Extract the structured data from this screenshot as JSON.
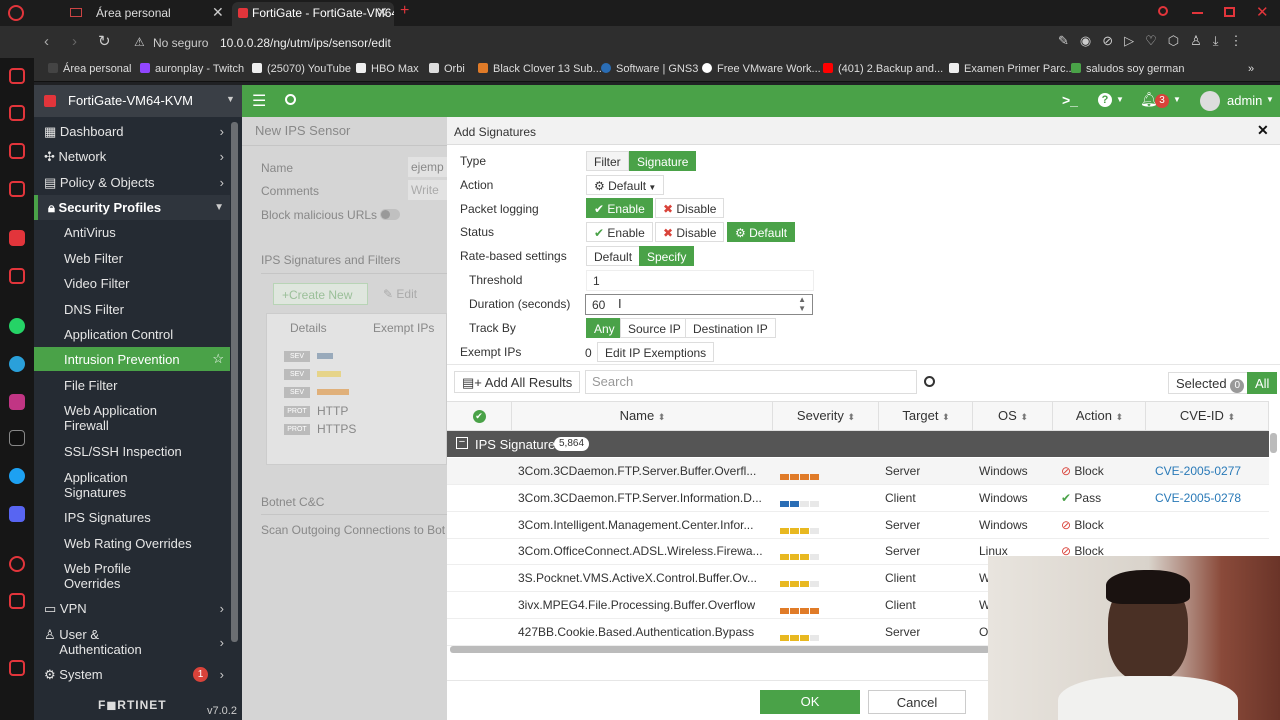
{
  "browser": {
    "tabs": [
      {
        "title": "Área personal"
      },
      {
        "title": "FortiGate - FortiGate-VM64"
      }
    ],
    "new_tab": "+",
    "url_prefix": "No seguro",
    "url": "10.0.0.28/ng/utm/ips/sensor/edit",
    "bookmarks": [
      "Área personal",
      "auronplay - Twitch",
      "(25070) YouTube",
      "HBO Max",
      "Orbi",
      "Black Clover 13 Sub...",
      "Software | GNS3",
      "Free VMware Work...",
      "(401) 2.Backup and...",
      "Examen Primer Parc...",
      "saludos soy german"
    ]
  },
  "header": {
    "device": "FortiGate-VM64-KVM",
    "notif_count": "3",
    "user": "admin"
  },
  "sidebar": {
    "items": [
      {
        "label": "Dashboard"
      },
      {
        "label": "Network"
      },
      {
        "label": "Policy & Objects"
      },
      {
        "label": "Security Profiles"
      },
      {
        "label": "AntiVirus"
      },
      {
        "label": "Web Filter"
      },
      {
        "label": "Video Filter"
      },
      {
        "label": "DNS Filter"
      },
      {
        "label": "Application Control"
      },
      {
        "label": "Intrusion Prevention"
      },
      {
        "label": "File Filter"
      },
      {
        "label": "Web Application Firewall"
      },
      {
        "label": "SSL/SSH Inspection"
      },
      {
        "label": "Application Signatures"
      },
      {
        "label": "IPS Signatures"
      },
      {
        "label": "Web Rating Overrides"
      },
      {
        "label": "Web Profile Overrides"
      },
      {
        "label": "VPN"
      },
      {
        "label": "User & Authentication"
      },
      {
        "label": "System"
      }
    ],
    "system_badge": "1",
    "brand": "F◼RTINET",
    "version": "v7.0.2"
  },
  "content": {
    "title": "New IPS Sensor",
    "name_label": "Name",
    "name_value": "ejemp",
    "comments_label": "Comments",
    "comments_placeholder": "Write",
    "block_label": "Block malicious URLs",
    "section": "IPS Signatures and Filters",
    "create_new": "Create New",
    "edit": "Edit",
    "col_details": "Details",
    "col_exempt": "Exempt IPs",
    "tags": [
      "SEV",
      "SEV",
      "SEV",
      "PROT",
      "PROT"
    ],
    "protocols": [
      "HTTP",
      "HTTPS"
    ],
    "botnet": "Botnet C&C",
    "scan": "Scan Outgoing Connections to Bot"
  },
  "modal": {
    "title": "Add Signatures",
    "type_label": "Type",
    "type_filter": "Filter",
    "type_signature": "Signature",
    "action_label": "Action",
    "action_value": "Default",
    "logging_label": "Packet logging",
    "enable": "Enable",
    "disable": "Disable",
    "status_label": "Status",
    "status_default": "Default",
    "rate_label": "Rate-based settings",
    "rate_default": "Default",
    "rate_specify": "Specify",
    "threshold_label": "Threshold",
    "threshold_value": "1",
    "duration_label": "Duration (seconds)",
    "duration_value": "60",
    "track_label": "Track By",
    "track_any": "Any",
    "track_source": "Source IP",
    "track_dest": "Destination IP",
    "exempt_label": "Exempt IPs",
    "exempt_count": "0",
    "exempt_button": "Edit IP Exemptions",
    "add_all": "Add All Results",
    "search_placeholder": "Search",
    "selected_label": "Selected",
    "selected_count": "0",
    "all": "All",
    "columns": [
      "Name",
      "Severity",
      "Target",
      "OS",
      "Action",
      "CVE-ID"
    ],
    "group_label": "IPS Signature",
    "group_count": "5,864",
    "rows": [
      {
        "name": "3Com.3CDaemon.FTP.Server.Buffer.Overfl...",
        "severity": 4,
        "sev_color": "#e07b28",
        "target": "Server",
        "os": "Windows",
        "action": "Block",
        "cve": "CVE-2005-0277"
      },
      {
        "name": "3Com.3CDaemon.FTP.Server.Information.D...",
        "severity": 2,
        "sev_color": "#2a6db5",
        "target": "Client",
        "os": "Windows",
        "action": "Pass",
        "cve": "CVE-2005-0278"
      },
      {
        "name": "3Com.Intelligent.Management.Center.Infor...",
        "severity": 3,
        "sev_color": "#e8b820",
        "target": "Server",
        "os": "Windows",
        "action": "Block",
        "cve": ""
      },
      {
        "name": "3Com.OfficeConnect.ADSL.Wireless.Firewa...",
        "severity": 3,
        "sev_color": "#e8b820",
        "target": "Server",
        "os": "Linux",
        "action": "Block",
        "cve": ""
      },
      {
        "name": "3S.Pocknet.VMS.ActiveX.Control.Buffer.Ov...",
        "severity": 3,
        "sev_color": "#e8b820",
        "target": "Client",
        "os": "W",
        "action": "",
        "cve": ""
      },
      {
        "name": "3ivx.MPEG4.File.Processing.Buffer.Overflow",
        "severity": 4,
        "sev_color": "#e07b28",
        "target": "Client",
        "os": "W",
        "action": "",
        "cve": ""
      },
      {
        "name": "427BB.Cookie.Based.Authentication.Bypass",
        "severity": 3,
        "sev_color": "#e8b820",
        "target": "Server",
        "os": "O",
        "action": "",
        "cve": ""
      }
    ],
    "ok": "OK",
    "cancel": "Cancel"
  }
}
